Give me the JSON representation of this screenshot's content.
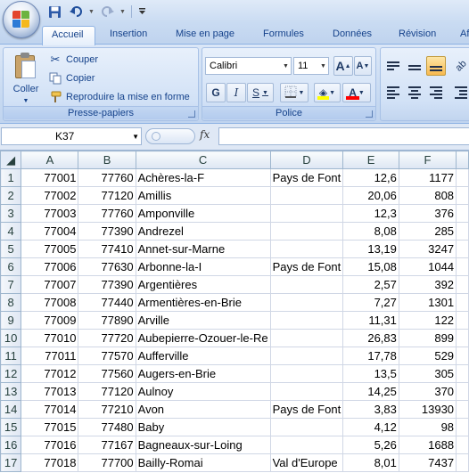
{
  "quick_access": {
    "save_icon": "save-icon",
    "undo_icon": "undo-icon",
    "redo_icon": "redo-icon",
    "customize_icon": "customize-qat-icon"
  },
  "tabs": [
    "Accueil",
    "Insertion",
    "Mise en page",
    "Formules",
    "Données",
    "Révision",
    "Af"
  ],
  "clipboard": {
    "paste_label": "Coller",
    "cut_label": "Couper",
    "copy_label": "Copier",
    "format_painter_label": "Reproduire la mise en forme",
    "group_label": "Presse-papiers"
  },
  "font_group": {
    "font_name": "Calibri",
    "font_size": "11",
    "bold": "G",
    "italic": "I",
    "underline": "S",
    "grow_label": "A",
    "shrink_label": "A",
    "group_label": "Police",
    "fill_color": "#ffff00",
    "font_color": "#ff0000"
  },
  "formula_bar": {
    "name_box": "K37",
    "fx_label": "fx",
    "formula": ""
  },
  "columns": [
    "A",
    "B",
    "C",
    "D",
    "E",
    "F"
  ],
  "rows": [
    {
      "n": "1",
      "a": "77001",
      "b": "77760",
      "c": "Achères-la-F",
      "d": "Pays de Font",
      "e": "12,6",
      "f": "1177"
    },
    {
      "n": "2",
      "a": "77002",
      "b": "77120",
      "c": "Amillis",
      "d": "",
      "e": "20,06",
      "f": "808"
    },
    {
      "n": "3",
      "a": "77003",
      "b": "77760",
      "c": "Amponville",
      "d": "",
      "e": "12,3",
      "f": "376"
    },
    {
      "n": "4",
      "a": "77004",
      "b": "77390",
      "c": "Andrezel",
      "d": "",
      "e": "8,08",
      "f": "285"
    },
    {
      "n": "5",
      "a": "77005",
      "b": "77410",
      "c": "Annet-sur-Marne",
      "d": "",
      "e": "13,19",
      "f": "3247"
    },
    {
      "n": "6",
      "a": "77006",
      "b": "77630",
      "c": "Arbonne-la-I",
      "d": "Pays de Font",
      "e": "15,08",
      "f": "1044"
    },
    {
      "n": "7",
      "a": "77007",
      "b": "77390",
      "c": "Argentières",
      "d": "",
      "e": "2,57",
      "f": "392"
    },
    {
      "n": "8",
      "a": "77008",
      "b": "77440",
      "c": "Armentières-en-Brie",
      "d": "",
      "e": "7,27",
      "f": "1301"
    },
    {
      "n": "9",
      "a": "77009",
      "b": "77890",
      "c": "Arville",
      "d": "",
      "e": "11,31",
      "f": "122"
    },
    {
      "n": "10",
      "a": "77010",
      "b": "77720",
      "c": "Aubepierre-Ozouer-le-Re",
      "d": "",
      "e": "26,83",
      "f": "899"
    },
    {
      "n": "11",
      "a": "77011",
      "b": "77570",
      "c": "Aufferville",
      "d": "",
      "e": "17,78",
      "f": "529"
    },
    {
      "n": "12",
      "a": "77012",
      "b": "77560",
      "c": "Augers-en-Brie",
      "d": "",
      "e": "13,5",
      "f": "305"
    },
    {
      "n": "13",
      "a": "77013",
      "b": "77120",
      "c": "Aulnoy",
      "d": "",
      "e": "14,25",
      "f": "370"
    },
    {
      "n": "14",
      "a": "77014",
      "b": "77210",
      "c": "Avon",
      "d": "Pays de Font",
      "e": "3,83",
      "f": "13930"
    },
    {
      "n": "15",
      "a": "77015",
      "b": "77480",
      "c": "Baby",
      "d": "",
      "e": "4,12",
      "f": "98"
    },
    {
      "n": "16",
      "a": "77016",
      "b": "77167",
      "c": "Bagneaux-sur-Loing",
      "d": "",
      "e": "5,26",
      "f": "1688"
    },
    {
      "n": "17",
      "a": "77018",
      "b": "77700",
      "c": "Bailly-Romai",
      "d": "Val d'Europe",
      "e": "8,01",
      "f": "7437"
    }
  ]
}
